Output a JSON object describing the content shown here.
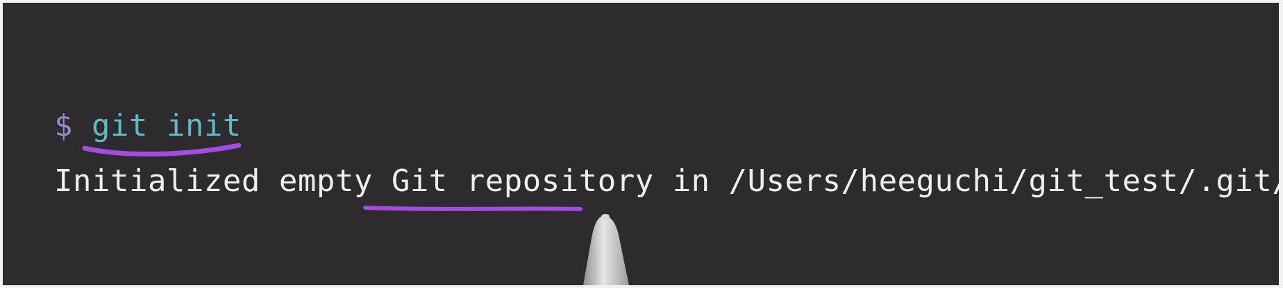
{
  "terminal": {
    "prompt": "$",
    "command": "git init",
    "output": "Initialized empty Git repository in /Users/heeguchi/git_test/.git/"
  },
  "colors": {
    "background": "#2d2b2e",
    "prompt": "#9a86c8",
    "command": "#5ebcc6",
    "output_text": "#efefef",
    "annotation_underline": "#a64ae0",
    "pen_tip": "#c9c9c9"
  },
  "annotations": [
    {
      "type": "underline",
      "target": "git init"
    },
    {
      "type": "underline",
      "target": "Git repository"
    }
  ],
  "overlay_icons": [
    "stylus-pen-icon"
  ]
}
